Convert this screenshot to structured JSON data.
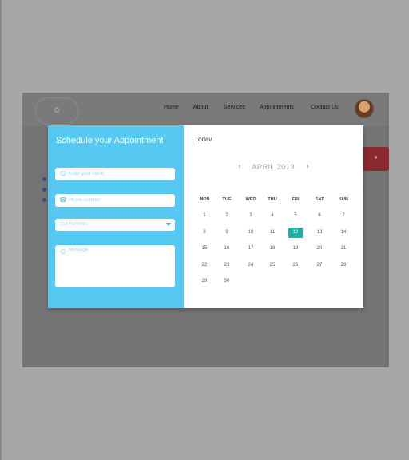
{
  "site": {
    "nav": [
      "Home",
      "About",
      "Services",
      "Appointments",
      "Contact  Us"
    ]
  },
  "form": {
    "title": "Schedule your Appointment",
    "name_placeholder": "Enter your name",
    "phone_placeholder": "Phone number",
    "service_selected": "Our Services",
    "message_placeholder": "Message"
  },
  "calendar": {
    "today_label": "Todav",
    "month_label": "APRIL 2013",
    "prev_arrow": "‹",
    "next_arrow": "›",
    "weekdays": [
      "MON",
      "TUE",
      "WED",
      "THU",
      "FRI",
      "SAT",
      "SUN"
    ],
    "weeks": [
      [
        "1",
        "2",
        "3",
        "4",
        "5",
        "6",
        "7"
      ],
      [
        "8",
        "9",
        "10",
        "11",
        "12",
        "13",
        "14"
      ],
      [
        "15",
        "16",
        "17",
        "18",
        "19",
        "20",
        "21"
      ],
      [
        "22",
        "23",
        "24",
        "25",
        "26",
        "27",
        "28"
      ],
      [
        "29",
        "30",
        "",
        "",
        "",
        "",
        ""
      ]
    ],
    "selected_day": "12",
    "selected_color": "#1ab2a4"
  },
  "colors": {
    "form_panel": "#56c9f2",
    "overlay": "#747474"
  }
}
